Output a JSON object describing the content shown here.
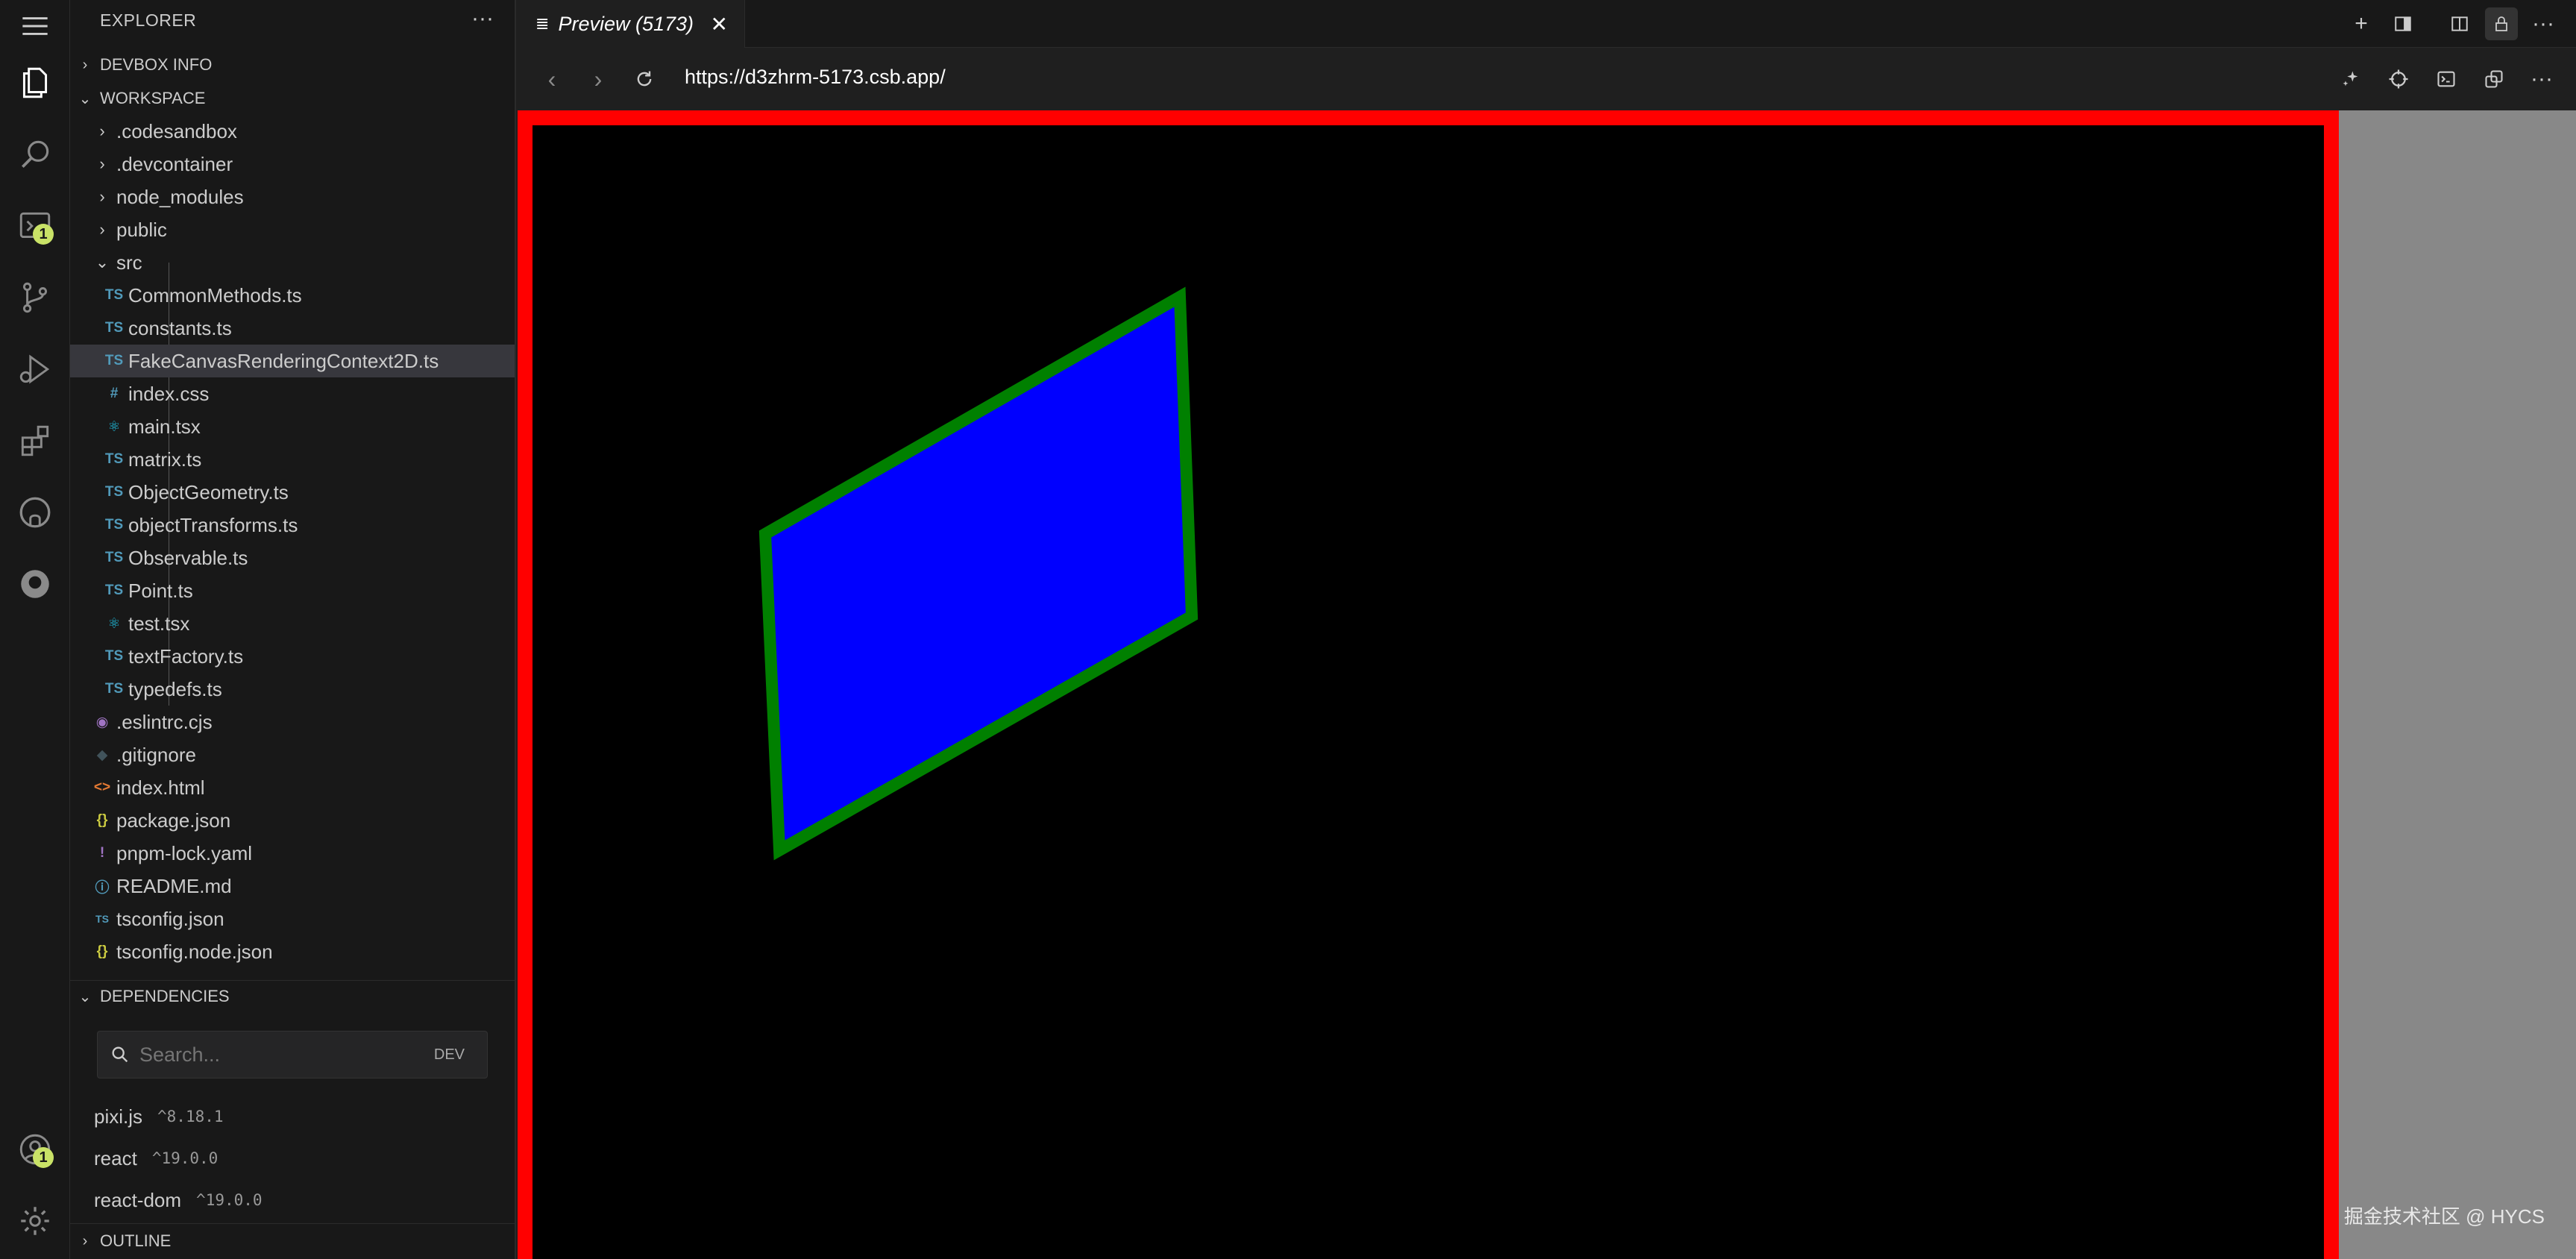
{
  "sidebar": {
    "title": "EXPLORER",
    "more": "···",
    "sections": {
      "devbox": "DEVBOX INFO",
      "workspace": "WORKSPACE",
      "dependencies": "DEPENDENCIES",
      "outline": "OUTLINE"
    },
    "folders": [
      ".codesandbox",
      ".devcontainer",
      "node_modules",
      "public",
      "src"
    ],
    "src_files": [
      {
        "name": "CommonMethods.ts",
        "icon": "TS"
      },
      {
        "name": "constants.ts",
        "icon": "TS"
      },
      {
        "name": "FakeCanvasRenderingContext2D.ts",
        "icon": "TS"
      },
      {
        "name": "index.css",
        "icon": "#"
      },
      {
        "name": "main.tsx",
        "icon": "⚛"
      },
      {
        "name": "matrix.ts",
        "icon": "TS"
      },
      {
        "name": "ObjectGeometry.ts",
        "icon": "TS"
      },
      {
        "name": "objectTransforms.ts",
        "icon": "TS"
      },
      {
        "name": "Observable.ts",
        "icon": "TS"
      },
      {
        "name": "Point.ts",
        "icon": "TS"
      },
      {
        "name": "test.tsx",
        "icon": "⚛"
      },
      {
        "name": "textFactory.ts",
        "icon": "TS"
      },
      {
        "name": "typedefs.ts",
        "icon": "TS"
      }
    ],
    "root_files": [
      {
        "name": ".eslintrc.cjs",
        "icon": "◉"
      },
      {
        "name": ".gitignore",
        "icon": "◆"
      },
      {
        "name": "index.html",
        "icon": "<>"
      },
      {
        "name": "package.json",
        "icon": "{}"
      },
      {
        "name": "pnpm-lock.yaml",
        "icon": "!"
      },
      {
        "name": "README.md",
        "icon": "ⓘ"
      },
      {
        "name": "tsconfig.json",
        "icon": "TS"
      },
      {
        "name": "tsconfig.node.json",
        "icon": "{}"
      }
    ],
    "dep_search": {
      "placeholder": "Search...",
      "dev_label": "DEV"
    },
    "dependencies": [
      {
        "name": "pixi.js",
        "version": "^8.18.1"
      },
      {
        "name": "react",
        "version": "^19.0.0"
      },
      {
        "name": "react-dom",
        "version": "^19.0.0"
      }
    ]
  },
  "activity": {
    "badge_sandbox": "1",
    "badge_account": "1"
  },
  "tab": {
    "label": "Preview (5173)"
  },
  "browser": {
    "url": "https://d3zhrm-5173.csb.app/"
  },
  "canvas_shape": {
    "fill": "#0000ff",
    "stroke": "#008000"
  },
  "watermark": "掘金技术社区 @ HYCS",
  "colors": {
    "frame": "#ff0000",
    "badge": "#c9e267"
  }
}
